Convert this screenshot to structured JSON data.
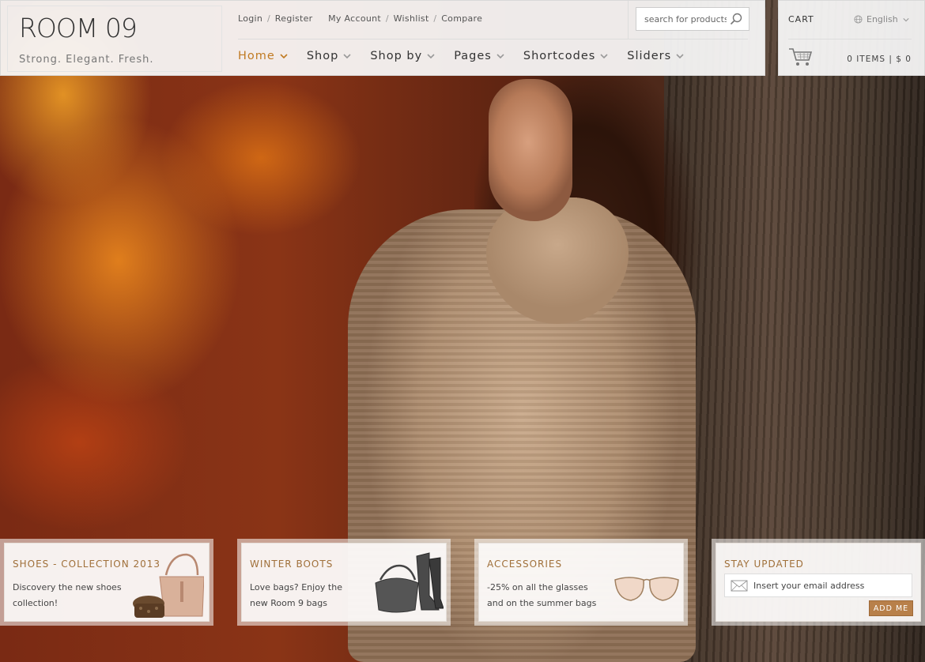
{
  "brand": {
    "logo": "ROOM 09",
    "tagline": "Strong. Elegant. Fresh."
  },
  "toplinks": {
    "login": "Login",
    "register": "Register",
    "account": "My Account",
    "wishlist": "Wishlist",
    "compare": "Compare",
    "separator": "/"
  },
  "search": {
    "placeholder": "search for products"
  },
  "nav": {
    "items": [
      {
        "label": "Home",
        "active": true
      },
      {
        "label": "Shop"
      },
      {
        "label": "Shop by"
      },
      {
        "label": "Pages"
      },
      {
        "label": "Shortcodes"
      },
      {
        "label": "Sliders"
      }
    ]
  },
  "cart": {
    "label": "CART",
    "language": "English",
    "summary": "0 ITEMS | $ 0"
  },
  "promos": [
    {
      "title": "SHOES - COLLECTION 2013",
      "text": "Discovery the new shoes collection!",
      "icon": "handbag-shoes-image"
    },
    {
      "title": "WINTER BOOTS",
      "text": "Love bags? Enjoy the new Room 9 bags",
      "icon": "boots-bag-image"
    },
    {
      "title": "ACCESSORIES",
      "text": "-25% on all the glasses and on the summer bags",
      "icon": "sunglasses-image"
    }
  ],
  "newsletter": {
    "title": "STAY UPDATED",
    "placeholder": "Insert your email address",
    "button": "ADD ME"
  },
  "colors": {
    "accent": "#c07a22",
    "promo_title": "#a0703a",
    "button": "#b8804a"
  }
}
